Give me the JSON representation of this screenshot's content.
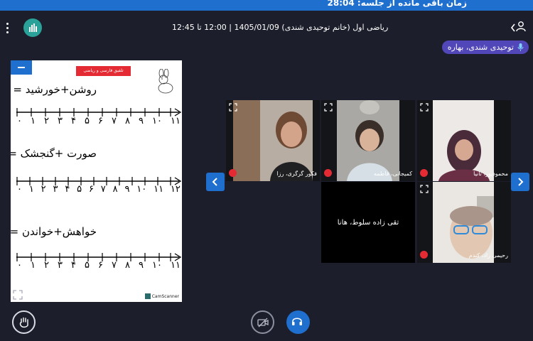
{
  "session": {
    "time_remaining_text": "زمان باقی مانده از جلسه: 28:04"
  },
  "header": {
    "meeting_title": "ریاضی اول (خانم توحیدی شندی) 1405/01/09 | 12:00 تا 12:45",
    "active_speaker": "توحیدی شندی، بهاره"
  },
  "shared_content": {
    "tag": "تلفیق فارسی و ریاضی",
    "equations": [
      "روشن+خورشید =",
      "صورت +گنجشک =",
      "خواهش+خواندن ="
    ],
    "number_lines": [
      [
        "۰",
        "۱",
        "۲",
        "۳",
        "۴",
        "۵",
        "۶",
        "۷",
        "۸",
        "۹",
        "۱۰",
        "۱۱"
      ],
      [
        "۰",
        "۱",
        "۲",
        "۳",
        "۴",
        "۵",
        "۶",
        "۷",
        "۸",
        "۹",
        "۱۰",
        "۱۱",
        "۱۲"
      ],
      [
        "۰",
        "۱",
        "۲",
        "۳",
        "۴",
        "۵",
        "۶",
        "۷",
        "۸",
        "۹",
        "۱۰",
        "۱۱"
      ]
    ],
    "watermark": "CamScanner"
  },
  "participants": [
    {
      "name": "فکور گرگری، رزا",
      "video": true,
      "muted": true
    },
    {
      "name": "کمیجانی، فاطمه",
      "video": true,
      "muted": true
    },
    {
      "name": "محمودپور، تانیا",
      "video": true,
      "muted": true
    },
    {
      "name": "تقی زاده سلوط، هانا",
      "video": false,
      "muted": false
    },
    {
      "name": "رحیمی راد، کندم",
      "video": true,
      "muted": true
    }
  ],
  "colors": {
    "accent_blue": "#1f6fcf",
    "speaker_purple": "#5147b8",
    "mute_red": "#e42b34",
    "stats_teal": "#2aa199",
    "background": "#1c1f2b"
  }
}
